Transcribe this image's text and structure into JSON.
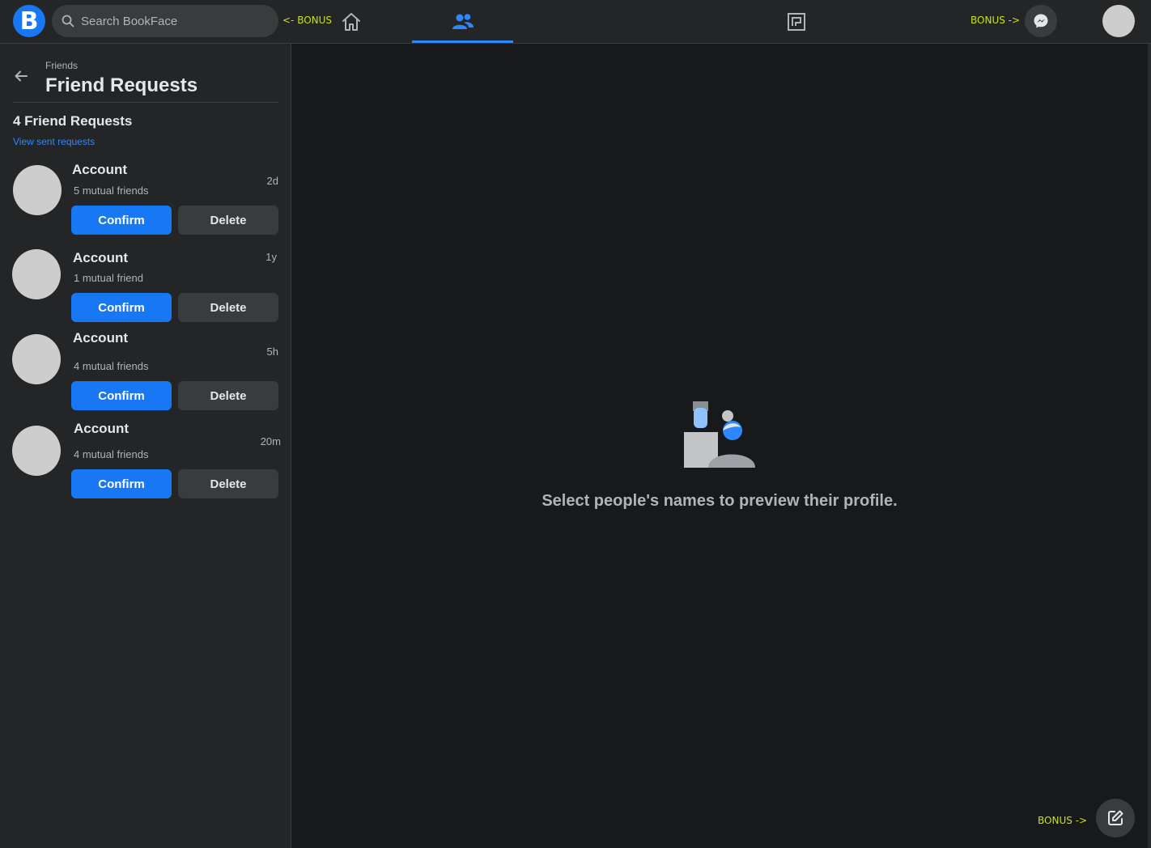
{
  "app": {
    "logo_letter": "B",
    "search_placeholder": "Search BookFace",
    "bonus_left": "<- BONUS",
    "bonus_right": "BONUS ->",
    "bonus_bottom": "BONUS ->",
    "nav": [
      {
        "name": "home",
        "icon": "home-icon",
        "active": false
      },
      {
        "name": "friends",
        "icon": "friends-icon",
        "active": true
      },
      {
        "name": "gaming",
        "icon": "gaming-icon",
        "active": false
      }
    ],
    "accent_color": "#1877f2",
    "bonus_color": "#c5e316"
  },
  "sidebar": {
    "breadcrumb": "Friends",
    "title": "Friend Requests",
    "count_label": "4 Friend Requests",
    "sent_link": "View sent requests",
    "requests": [
      {
        "name": "Account",
        "mutual": "5 mutual friends",
        "time": "2d",
        "confirm": "Confirm",
        "delete": "Delete"
      },
      {
        "name": "Account",
        "mutual": "1 mutual friend",
        "time": "1y",
        "confirm": "Confirm",
        "delete": "Delete"
      },
      {
        "name": "Account",
        "mutual": "4 mutual friends",
        "time": "5h",
        "confirm": "Confirm",
        "delete": "Delete"
      },
      {
        "name": "Account",
        "mutual": "4 mutual friends",
        "time": "20m",
        "confirm": "Confirm",
        "delete": "Delete"
      }
    ]
  },
  "main": {
    "empty_message": "Select people's names to preview their profile."
  }
}
